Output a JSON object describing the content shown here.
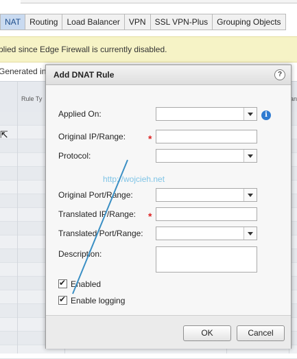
{
  "tabs": [
    {
      "label": "NAT",
      "active": true
    },
    {
      "label": "Routing",
      "active": false
    },
    {
      "label": "Load Balancer",
      "active": false
    },
    {
      "label": "VPN",
      "active": false
    },
    {
      "label": "SSL VPN-Plus",
      "active": false
    },
    {
      "label": "Grouping Objects",
      "active": false
    }
  ],
  "warning_text": "plied since Edge Firewall is currently disabled.",
  "filter_text": "Generated in",
  "grid": {
    "col_rule_type": "Rule Ty",
    "col_right": "ana"
  },
  "dialog": {
    "title": "Add DNAT Rule",
    "help_symbol": "?",
    "fields": {
      "applied_on": {
        "label": "Applied On:",
        "value": ""
      },
      "original_ip": {
        "label": "Original IP/Range:",
        "value": "",
        "required": true
      },
      "protocol": {
        "label": "Protocol:",
        "value": ""
      },
      "original_port": {
        "label": "Original Port/Range:",
        "value": ""
      },
      "translated_ip": {
        "label": "Translated IP/Range:",
        "value": "",
        "required": true
      },
      "translated_port": {
        "label": "Translated Port/Range:",
        "value": ""
      },
      "description": {
        "label": "Description:",
        "value": ""
      }
    },
    "required_mark": "*",
    "info_symbol": "i",
    "checkboxes": {
      "enabled": {
        "label": "Enabled",
        "checked": true
      },
      "enable_logging": {
        "label": "Enable logging",
        "checked": true
      }
    },
    "buttons": {
      "ok": "OK",
      "cancel": "Cancel"
    }
  },
  "watermark": "http://wojcieh.net",
  "colors": {
    "active_tab": "#c9daf0",
    "warning_bg": "#f6f3c6",
    "info_icon": "#2f7bd1",
    "annotation_arrow": "#3a8fc4"
  }
}
